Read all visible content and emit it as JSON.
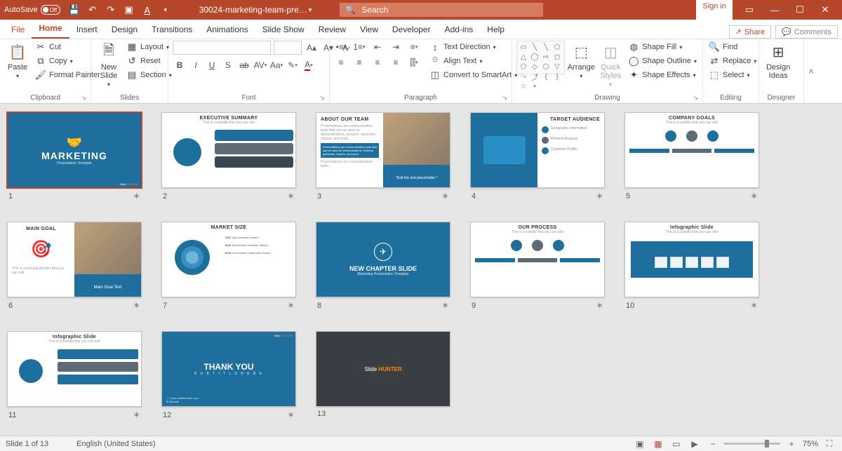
{
  "titlebar": {
    "autosave_label": "AutoSave",
    "autosave_state": "Off",
    "doc_title": "30024-marketing-team-pre…",
    "search_placeholder": "Search",
    "signin_label": "Sign in"
  },
  "menu": {
    "items": [
      "File",
      "Home",
      "Insert",
      "Design",
      "Transitions",
      "Animations",
      "Slide Show",
      "Review",
      "View",
      "Developer",
      "Add-ins",
      "Help"
    ],
    "active_index": 1,
    "share_label": "Share",
    "comments_label": "Comments"
  },
  "ribbon": {
    "clipboard": {
      "label": "Clipboard",
      "paste": "Paste",
      "cut": "Cut",
      "copy": "Copy",
      "format_painter": "Format Painter"
    },
    "slides": {
      "label": "Slides",
      "new_slide": "New\nSlide",
      "layout": "Layout",
      "reset": "Reset",
      "section": "Section"
    },
    "font": {
      "label": "Font"
    },
    "paragraph": {
      "label": "Paragraph",
      "text_direction": "Text Direction",
      "align_text": "Align Text",
      "convert_smartart": "Convert to SmartArt"
    },
    "drawing": {
      "label": "Drawing",
      "arrange": "Arrange",
      "quick_styles": "Quick\nStyles",
      "shape_fill": "Shape Fill",
      "shape_outline": "Shape Outline",
      "shape_effects": "Shape Effects"
    },
    "editing": {
      "label": "Editing",
      "find": "Find",
      "replace": "Replace",
      "select": "Select"
    },
    "designer": {
      "label": "Designer",
      "design_ideas": "Design\nIdeas"
    }
  },
  "slides": [
    {
      "n": 1,
      "title": "MARKETING",
      "subtitle": "Presentation Template",
      "has_transition": true
    },
    {
      "n": 2,
      "title": "EXECUTIVE SUMMARY",
      "has_transition": true
    },
    {
      "n": 3,
      "title": "ABOUT OUR TEAM",
      "caption": "\"Edit this text placeholder.\"",
      "has_transition": true
    },
    {
      "n": 4,
      "title": "TARGET AUDIENCE",
      "has_transition": true
    },
    {
      "n": 5,
      "title": "COMPANY GOALS",
      "has_transition": true
    },
    {
      "n": 6,
      "title": "MAIN GOAL",
      "caption": "Main Goal Text",
      "has_transition": true
    },
    {
      "n": 7,
      "title": "MARKET SIZE",
      "has_transition": true
    },
    {
      "n": 8,
      "title": "NEW CHAPTER SLIDE",
      "subtitle": "Marketing Presentation Template",
      "has_transition": true
    },
    {
      "n": 9,
      "title": "OUR PROCESS",
      "has_transition": true
    },
    {
      "n": 10,
      "title": "Infographic Slide",
      "has_transition": true
    },
    {
      "n": 11,
      "title": "Infographic Slide",
      "has_transition": true
    },
    {
      "n": 12,
      "title": "THANK YOU",
      "subtitle": "S U B T I T L E   H E R E",
      "has_transition": true
    },
    {
      "n": 13,
      "title": "Slide HUNTER",
      "has_transition": false
    }
  ],
  "selected_slide": 1,
  "statusbar": {
    "slide_counter": "Slide 1 of 13",
    "language": "English (United States)",
    "zoom": "75%"
  }
}
